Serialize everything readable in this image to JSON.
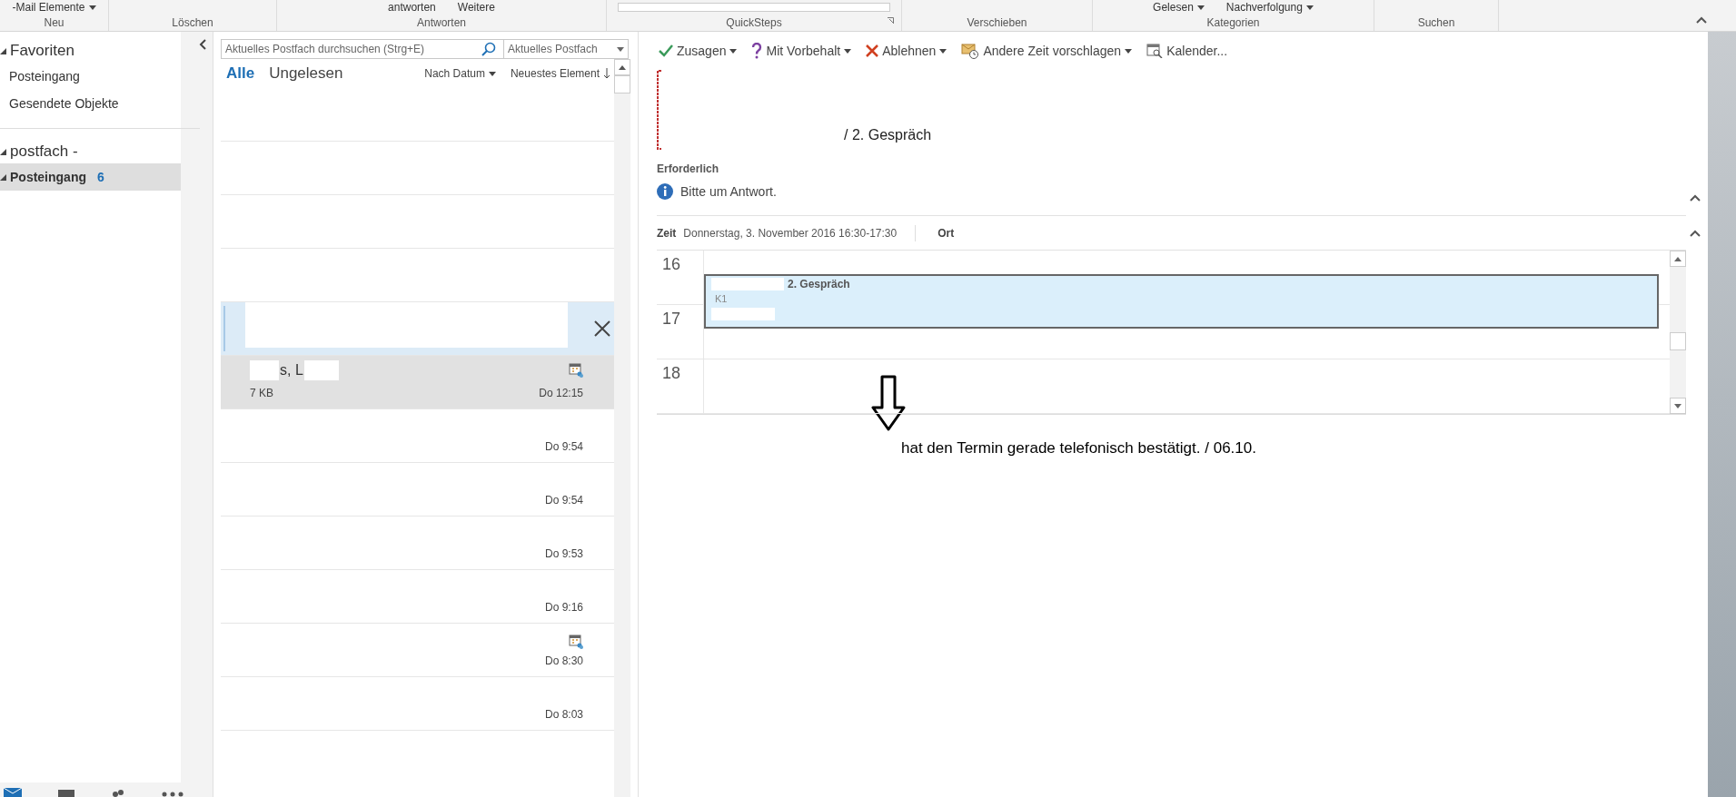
{
  "ribbon": {
    "groups": [
      {
        "label": "Neu",
        "items": [
          "-Mail  Elemente"
        ]
      },
      {
        "label": "Löschen"
      },
      {
        "label": "Antworten",
        "items": [
          "antworten",
          "Weitere"
        ]
      },
      {
        "label": "QuickSteps"
      },
      {
        "label": "Verschieben"
      },
      {
        "label": "Kategorien",
        "items": [
          "Gelesen",
          "Nachverfolgung"
        ]
      },
      {
        "label": "Suchen"
      }
    ]
  },
  "folder_pane": {
    "favorites": {
      "title": "Favoriten",
      "expanded": true,
      "items": [
        {
          "label": "Posteingang",
          "selected": false
        },
        {
          "label": "Gesendete Objekte",
          "selected": false
        }
      ]
    },
    "mailbox": {
      "title": "postfach -",
      "expanded": true,
      "folders": [
        {
          "label": "Posteingang",
          "count": "6",
          "selected": true
        }
      ]
    }
  },
  "search": {
    "placeholder": "Aktuelles Postfach durchsuchen (Strg+E)",
    "scope": "Aktuelles Postfach"
  },
  "filters": [
    {
      "label": "Alle",
      "selected": true
    },
    {
      "label": "Ungelesen",
      "selected": false
    }
  ],
  "sort": {
    "by": "Nach Datum",
    "order": "Neuestes Element"
  },
  "messages": [
    {
      "selected": false,
      "highlighted": false,
      "meeting": false
    },
    {
      "selected": false,
      "highlighted": false,
      "meeting": false
    },
    {
      "selected": false,
      "highlighted": false,
      "meeting": false
    },
    {
      "selected": false,
      "highlighted": false,
      "meeting": false
    },
    {
      "selected": true,
      "highlighted": false,
      "meeting": false
    },
    {
      "selected": false,
      "highlighted": true,
      "meeting": true,
      "sender": "s, L",
      "size": "7 KB",
      "time": "Do 12:15"
    },
    {
      "selected": false,
      "highlighted": false,
      "meeting": false,
      "time": "Do 9:54"
    },
    {
      "selected": false,
      "highlighted": false,
      "meeting": false,
      "time": "Do 9:54"
    },
    {
      "selected": false,
      "highlighted": false,
      "meeting": false,
      "time": "Do 9:53"
    },
    {
      "selected": false,
      "highlighted": false,
      "meeting": false,
      "time": "Do 9:16"
    },
    {
      "selected": false,
      "highlighted": false,
      "meeting": true,
      "time": "Do 8:30"
    },
    {
      "selected": false,
      "highlighted": false,
      "meeting": false,
      "time": "Do 8:03"
    }
  ],
  "reading_pane": {
    "responses": [
      {
        "kind": "accept",
        "label": "Zusagen",
        "has_menu": true
      },
      {
        "kind": "tentative",
        "label": "Mit Vorbehalt",
        "has_menu": true
      },
      {
        "kind": "decline",
        "label": "Ablehnen",
        "has_menu": true
      },
      {
        "kind": "propose",
        "label": "Andere Zeit vorschlagen",
        "has_menu": true
      },
      {
        "kind": "calendar",
        "label": "Kalender...",
        "has_menu": false
      }
    ],
    "subject": "/ 2. Gespräch",
    "required_label": "Erforderlich",
    "info": "Bitte um Antwort.",
    "time_label": "Zeit",
    "time_value": "Donnerstag, 3. November 2016 16:30-17:30",
    "location_label": "Ort",
    "calendar": {
      "hours": [
        "16",
        "17",
        "18"
      ],
      "appointment": {
        "title": "2. Gespräch",
        "location": "K1"
      }
    },
    "annotation": "hat den Termin gerade telefonisch bestätigt. / 06.10."
  }
}
